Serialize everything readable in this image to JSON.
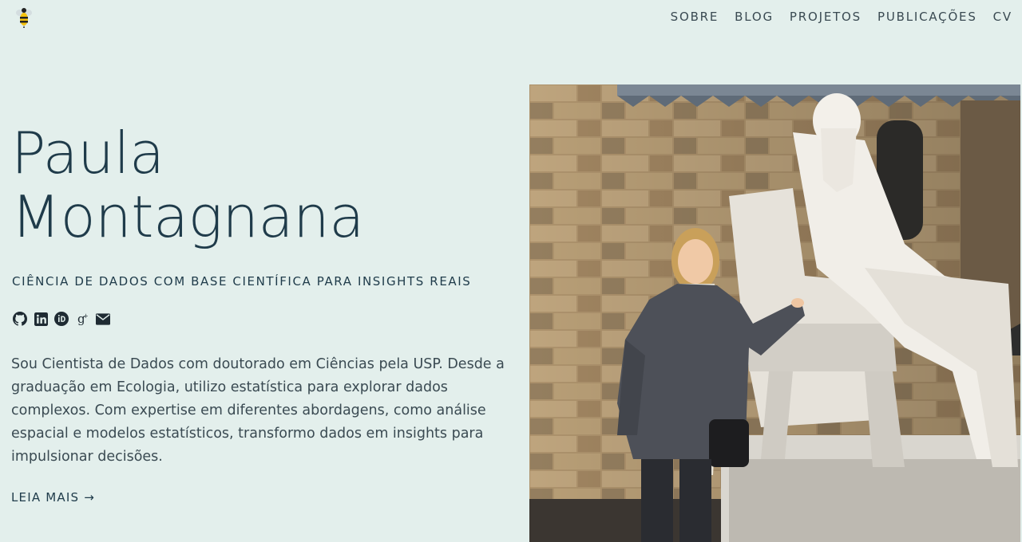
{
  "nav": {
    "items": [
      "SOBRE",
      "BLOG",
      "PROJETOS",
      "PUBLICAÇÕES",
      "CV"
    ]
  },
  "hero": {
    "name_line1": "Paula",
    "name_line2": "Montagnana",
    "tagline": "CIÊNCIA DE DADOS COM BASE CIENTÍFICA PARA INSIGHTS REAIS",
    "bio": "Sou Cientista de Dados com doutorado em Ciências pela USP. Desde a graduação em Ecologia, utilizo estatística para explorar dados complexos. Com expertise em diferentes abordagens, como análise espacial e modelos estatísticos, transformo dados em insights para impulsionar decisões.",
    "read_more": "LEIA MAIS →"
  },
  "social": [
    "github-icon",
    "linkedin-icon",
    "orcid-icon",
    "google-scholar-icon",
    "email-icon"
  ],
  "colors": {
    "background": "#e3efec",
    "heading": "#1f3b4a",
    "body_text": "#3a4a52"
  }
}
